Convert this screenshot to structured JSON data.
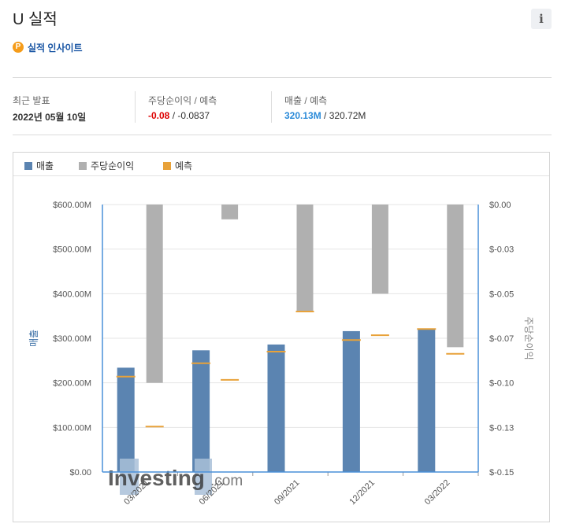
{
  "header": {
    "title": "U 실적",
    "info_label": "i"
  },
  "insight": {
    "label": "실적 인사이트",
    "icon": "P"
  },
  "stats": {
    "latest": {
      "label": "최근 발표",
      "value": "2022년 05월 10일"
    },
    "eps": {
      "label": "주당순이익 / 예측",
      "actual": "-0.08",
      "sep": " / ",
      "forecast": "-0.0837"
    },
    "revenue": {
      "label": "매출 / 예측",
      "actual": "320.13M",
      "sep": " / ",
      "forecast": "320.72M"
    }
  },
  "legend": {
    "revenue": "매출",
    "eps": "주당순이익",
    "forecast": "예측"
  },
  "colors": {
    "revenue": "#5b84b1",
    "eps": "#b0b0b0",
    "forecast": "#e8a23a",
    "axis": "#4a90d9"
  },
  "watermark": {
    "brand": "Investing",
    "suffix": ".com"
  },
  "chart_data": {
    "type": "bar",
    "categories": [
      "03/2021",
      "06/2021",
      "09/2021",
      "12/2021",
      "03/2022"
    ],
    "series": [
      {
        "name": "매출",
        "axis": "left",
        "values": [
          234,
          273,
          286,
          316,
          320.13
        ]
      },
      {
        "name": "주당순이익",
        "axis": "right",
        "values": [
          -0.1,
          -0.0083,
          -0.06,
          -0.05,
          -0.08
        ]
      }
    ],
    "forecast": {
      "name": "예측",
      "revenue": [
        214,
        244,
        270,
        296,
        320.72
      ],
      "eps": [
        -0.1245,
        -0.0983,
        -0.06,
        -0.0733,
        -0.0837
      ]
    },
    "ylabel": "매출",
    "ylabel_right": "주당순이익",
    "ylim": [
      0,
      600
    ],
    "ylim_right": [
      -0.15,
      0
    ],
    "yticks": [
      "$600.00M",
      "$500.00M",
      "$400.00M",
      "$300.00M",
      "$200.00M",
      "$100.00M",
      "$0.00"
    ],
    "yticks_right": [
      "$0.00",
      "$-0.03",
      "$-0.05",
      "$-0.07",
      "$-0.10",
      "$-0.13",
      "$-0.15"
    ],
    "grid": true,
    "legend_position": "top-left"
  }
}
